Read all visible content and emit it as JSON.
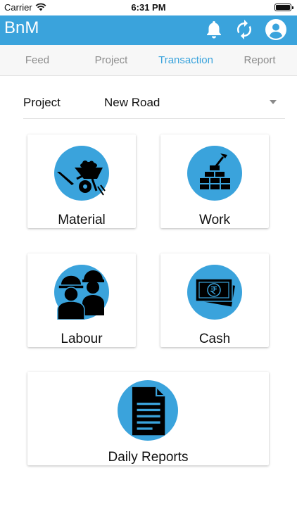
{
  "status": {
    "carrier": "Carrier",
    "time": "6:31 PM"
  },
  "app": {
    "title": "BnM"
  },
  "tabs": [
    {
      "label": "Feed"
    },
    {
      "label": "Project"
    },
    {
      "label": "Transaction"
    },
    {
      "label": "Report"
    }
  ],
  "active_tab": "Transaction",
  "project": {
    "label": "Project",
    "value": "New Road"
  },
  "tiles": [
    {
      "label": "Material",
      "icon": "wheelbarrow-icon"
    },
    {
      "label": "Work",
      "icon": "trowel-bricks-icon"
    },
    {
      "label": "Labour",
      "icon": "workers-icon"
    },
    {
      "label": "Cash",
      "icon": "rupee-cash-icon"
    },
    {
      "label": "Daily Reports",
      "icon": "document-icon"
    }
  ],
  "colors": {
    "primary": "#3aa3dc",
    "tab_inactive": "#8c8c8c",
    "background": "#ffffff"
  }
}
